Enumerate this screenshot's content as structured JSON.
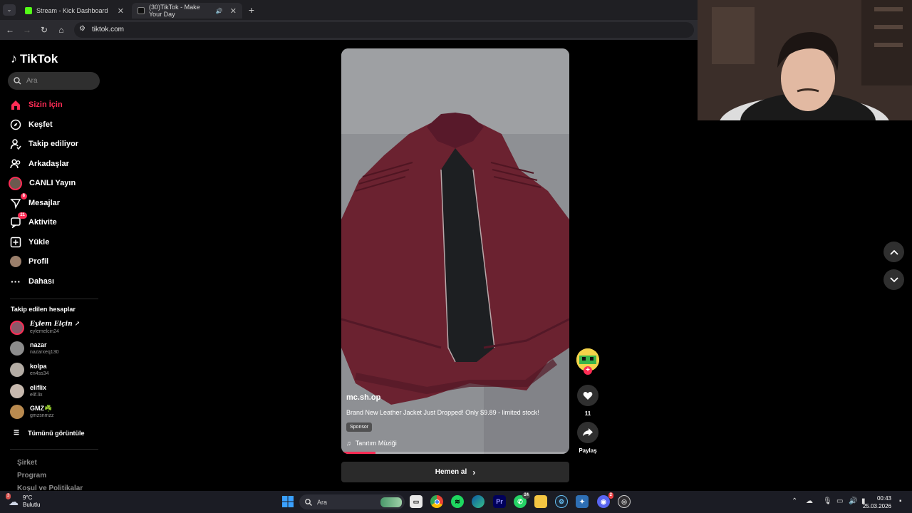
{
  "browser": {
    "tabs": [
      {
        "title": "Stream - Kick Dashboard",
        "icon": "kick-icon",
        "color": "#53fc18"
      },
      {
        "title": "(30)TikTok - Make Your Day",
        "icon": "tiktok-icon",
        "color": "#ffffff"
      }
    ],
    "url": "tiktok.com"
  },
  "sidebar": {
    "logo": "TikTok",
    "search_placeholder": "Ara",
    "nav": [
      {
        "label": "Sizin İçin",
        "icon": "home-icon",
        "active": true
      },
      {
        "label": "Keşfet",
        "icon": "compass-icon"
      },
      {
        "label": "Takip ediliyor",
        "icon": "following-icon"
      },
      {
        "label": "Arkadaşlar",
        "icon": "friends-icon"
      },
      {
        "label": "CANLI Yayın",
        "icon": "live-avatar-icon"
      },
      {
        "label": "Mesajlar",
        "icon": "messages-icon",
        "badge": "8"
      },
      {
        "label": "Aktivite",
        "icon": "activity-icon",
        "badge": "21"
      },
      {
        "label": "Yükle",
        "icon": "upload-icon"
      },
      {
        "label": "Profil",
        "icon": "profile-avatar-icon"
      },
      {
        "label": "Dahası",
        "icon": "more-icon"
      }
    ],
    "following_title": "Takip edilen hesaplar",
    "accounts": [
      {
        "name": "𝑬𝒚𝒍𝒆𝒎 𝑬𝒍ç𝒊𝒏 ↗",
        "handle": "eylemelcin24"
      },
      {
        "name": "nazar",
        "handle": "nazarxeq130"
      },
      {
        "name": "kolpa",
        "handle": "en4ss34"
      },
      {
        "name": "eliflix",
        "handle": "elif.lix"
      },
      {
        "name": "GMZ☘️",
        "handle": "gmzsnmzz"
      }
    ],
    "see_all": "Tümünü görüntüle",
    "footer": [
      "Şirket",
      "Program",
      "Koşul ve Politikalar"
    ]
  },
  "video": {
    "author": "mc.sh.op",
    "caption": "Brand New Leather Jacket Just Dropped! Only $9.89 - limited stock!",
    "sponsor_label": "Sponsor",
    "music": "Tanıtım Müziği",
    "progress": 0.15,
    "cta": "Hemen al"
  },
  "actions": {
    "likes": "11",
    "share_label": "Paylaş"
  },
  "taskbar": {
    "weather_temp": "9°C",
    "weather_desc": "Bulutlu",
    "weather_badge": "3",
    "search_placeholder": "Ara",
    "whatsapp_badge": "24",
    "discord_badge": "2",
    "time": "00:43",
    "date": "25.03.2026"
  },
  "colors": {
    "accent": "#fe2c55",
    "background": "#000000",
    "jacket": "#6b2230"
  }
}
